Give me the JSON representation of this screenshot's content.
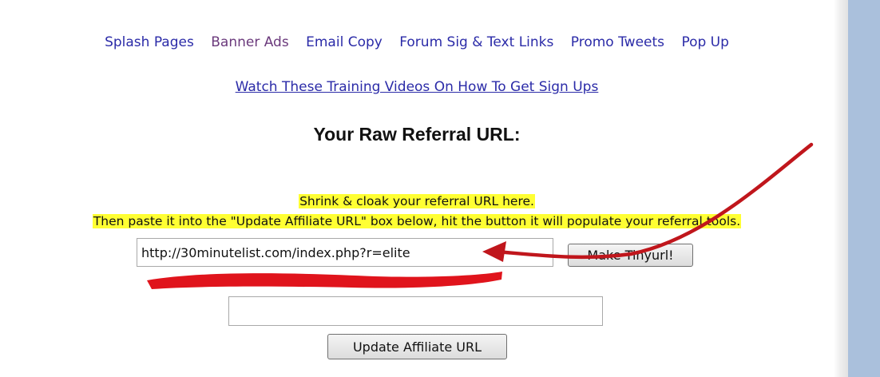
{
  "nav": {
    "links": [
      {
        "label": "Splash Pages"
      },
      {
        "label": "Banner Ads"
      },
      {
        "label": "Email Copy"
      },
      {
        "label": "Forum Sig & Text Links"
      },
      {
        "label": "Promo Tweets"
      },
      {
        "label": "Pop Up"
      }
    ]
  },
  "training_link": "Watch These Training Videos On How To Get Sign Ups",
  "heading": "Your Raw Referral URL:",
  "instructions": {
    "line1": "Shrink & cloak your referral URL here.",
    "line2": "Then paste it into the \"Update Affiliate URL\" box below, hit the button it will populate your referral tools."
  },
  "referral_input": {
    "value": "http://30minutelist.com/index.php?r=elite"
  },
  "tinyurl_button": "Make Tinyurl!",
  "affiliate_input": {
    "value": ""
  },
  "update_button": "Update Affiliate URL",
  "colors": {
    "link": "#2b2ba8",
    "visited_link": "#6b3a7c",
    "highlight": "#ffff33",
    "annotation": "#c0161c",
    "side_panel": "#aac0dc"
  }
}
